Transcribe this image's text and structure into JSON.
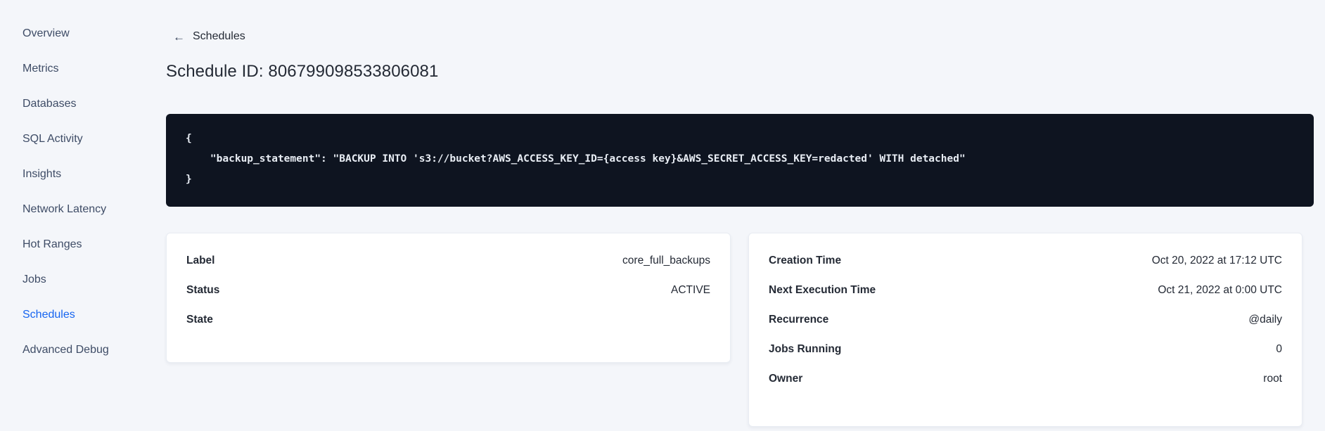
{
  "colors": {
    "accent": "#1765f0",
    "ink": "#242a35",
    "sidebar_text": "#3e4c66",
    "page_bg": "#f4f6fa",
    "code_bg": "#0e1420",
    "code_fg": "#e8edf4"
  },
  "sidebar": {
    "items": [
      {
        "label": "Overview",
        "active": false
      },
      {
        "label": "Metrics",
        "active": false
      },
      {
        "label": "Databases",
        "active": false
      },
      {
        "label": "SQL Activity",
        "active": false
      },
      {
        "label": "Insights",
        "active": false
      },
      {
        "label": "Network Latency",
        "active": false
      },
      {
        "label": "Hot Ranges",
        "active": false
      },
      {
        "label": "Jobs",
        "active": false
      },
      {
        "label": "Schedules",
        "active": true
      },
      {
        "label": "Advanced Debug",
        "active": false
      }
    ]
  },
  "header": {
    "back_icon": "←",
    "back_label": "Schedules",
    "title": "Schedule ID: 806799098533806081"
  },
  "code_block": {
    "lines": [
      "{",
      "    \"backup_statement\": \"BACKUP INTO 's3://bucket?AWS_ACCESS_KEY_ID={access key}&AWS_SECRET_ACCESS_KEY=redacted' WITH detached\"",
      "}"
    ]
  },
  "details_left": {
    "rows": [
      {
        "label": "Label",
        "value": "core_full_backups"
      },
      {
        "label": "Status",
        "value": "ACTIVE"
      },
      {
        "label": "State",
        "value": ""
      }
    ]
  },
  "details_right": {
    "rows": [
      {
        "label": "Creation Time",
        "value": "Oct 20, 2022 at 17:12 UTC"
      },
      {
        "label": "Next Execution Time",
        "value": "Oct 21, 2022 at 0:00 UTC"
      },
      {
        "label": "Recurrence",
        "value": "@daily"
      },
      {
        "label": "Jobs Running",
        "value": "0"
      },
      {
        "label": "Owner",
        "value": "root"
      }
    ]
  }
}
